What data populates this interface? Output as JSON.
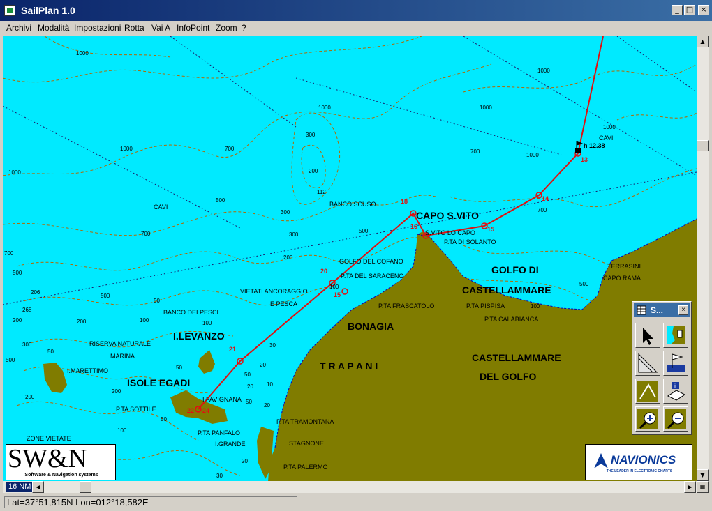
{
  "window": {
    "title": "SailPlan 1.0"
  },
  "menu": [
    "Archivi",
    "Modalità",
    "Impostazioni",
    "Rotta",
    "Vai A",
    "InfoPoint",
    "Zoom",
    "?"
  ],
  "title_buttons": {
    "minimize": "_",
    "maximize": "□",
    "close": "×"
  },
  "map": {
    "regions": [
      {
        "id": "capo",
        "text": "CAPO S.VITO"
      },
      {
        "id": "golfo1",
        "text": "GOLFO DI"
      },
      {
        "id": "golfo2",
        "text": "CASTELLAMMARE"
      },
      {
        "id": "bonagia",
        "text": "BONAGIA"
      },
      {
        "id": "trapani",
        "text": "T R A P A N I"
      },
      {
        "id": "cast1",
        "text": "CASTELLAMMARE"
      },
      {
        "id": "cast2",
        "text": "DEL GOLFO"
      },
      {
        "id": "levanzo",
        "text": "I.LEVANZO"
      },
      {
        "id": "egadi",
        "text": "ISOLE EGADI"
      }
    ],
    "places": [
      {
        "id": "bancoscuso",
        "text": "BANCO SCUSO"
      },
      {
        "id": "cavi1",
        "text": "CAVI"
      },
      {
        "id": "cavi2",
        "text": "CAVI"
      },
      {
        "id": "sanvito",
        "text": "S.VITO LO CAPO"
      },
      {
        "id": "solanto",
        "text": "P.TA DI SOLANTO"
      },
      {
        "id": "cofano",
        "text": "GOLFO DEL COFANO"
      },
      {
        "id": "saraceno",
        "text": "P.TA DEL SARACENO"
      },
      {
        "id": "frascatolo",
        "text": "P.TA FRASCATOLO"
      },
      {
        "id": "pispisa",
        "text": "P.TA PISPISA"
      },
      {
        "id": "calabianca",
        "text": "P.TA CALABIANCA"
      },
      {
        "id": "terrasini",
        "text": "TERRASINI"
      },
      {
        "id": "caporama",
        "text": "CAPO RAMA"
      },
      {
        "id": "vietati",
        "text": "VIETATI ANCORAGGIO"
      },
      {
        "id": "pesca",
        "text": "E PESCA"
      },
      {
        "id": "pesci",
        "text": "BANCO DEI PESCI"
      },
      {
        "id": "riserva",
        "text": "RISERVA NATURALE"
      },
      {
        "id": "marina",
        "text": "MARINA"
      },
      {
        "id": "marettimo",
        "text": "I.MARETTIMO"
      },
      {
        "id": "favignana",
        "text": "I.FAVIGNANA"
      },
      {
        "id": "sottile",
        "text": "P.TA SOTTILE"
      },
      {
        "id": "panfalo",
        "text": "P.TA PANFALO"
      },
      {
        "id": "grande",
        "text": "I.GRANDE"
      },
      {
        "id": "tramontana",
        "text": "P.TA TRAMONTANA"
      },
      {
        "id": "stagnone",
        "text": "STAGNONE"
      },
      {
        "id": "palermo",
        "text": "P.TA PALERMO"
      },
      {
        "id": "zone",
        "text": "ZONE VIETATE"
      }
    ],
    "depths": [
      "1000",
      "1000",
      "1000",
      "1000",
      "1000",
      "1000",
      "1000",
      "1000",
      "700",
      "700",
      "700",
      "700",
      "700",
      "500",
      "500",
      "500",
      "500",
      "500",
      "500",
      "300",
      "300",
      "300",
      "300",
      "200",
      "200",
      "200",
      "200",
      "200",
      "200",
      "112",
      "206",
      "268",
      "100",
      "100",
      "100",
      "100",
      "100",
      "50",
      "50",
      "50",
      "50",
      "50",
      "50",
      "30",
      "30",
      "20",
      "20",
      "20",
      "20",
      "10"
    ],
    "route": {
      "waypoints": [
        "13",
        "14",
        "15",
        "16",
        "18",
        "20",
        "15",
        "21",
        "24",
        "22"
      ],
      "eta": "h 12.38"
    }
  },
  "scale_label": "16 NM",
  "status": {
    "coords": "Lat=37°51,815N Lon=012°18,582E"
  },
  "palette": {
    "title": "S...",
    "close": "×",
    "tools": [
      "pointer-tool",
      "pan-tool",
      "measure-tool",
      "flag-tool",
      "route-tool",
      "info-tool",
      "zoom-in-tool",
      "zoom-out-tool"
    ]
  },
  "logos": {
    "swn": {
      "text": "SW&N",
      "subtitle": "SoftWare & Navigation systems"
    },
    "navionics": {
      "text": "NAVIONICS",
      "subtitle": "THE LEADER IN ELECTRONIC CHARTS"
    }
  },
  "colors": {
    "sea": "#00eaff",
    "land": "#807c00",
    "route": "#e01010",
    "contour": "#b06a00",
    "shore": "#0000c0"
  }
}
